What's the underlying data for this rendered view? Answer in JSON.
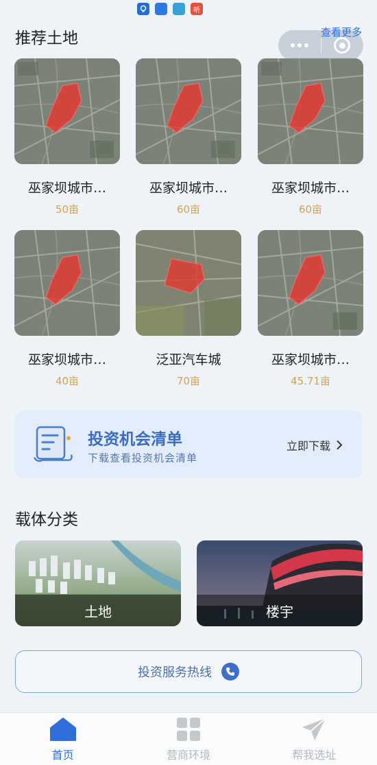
{
  "status_bar": {
    "app_badge": "听"
  },
  "header": {
    "title": "推荐土地",
    "view_more": "查看更多"
  },
  "lands": [
    {
      "name": "巫家坝城市…",
      "area": "50亩"
    },
    {
      "name": "巫家坝城市…",
      "area": "60亩"
    },
    {
      "name": "巫家坝城市…",
      "area": "60亩"
    },
    {
      "name": "巫家坝城市…",
      "area": "40亩"
    },
    {
      "name": "泛亚汽车城",
      "area": "70亩"
    },
    {
      "name": "巫家坝城市…",
      "area": "45.71亩"
    }
  ],
  "promo": {
    "title": "投资机会清单",
    "subtitle": "下载查看投资机会清单",
    "cta": "立即下载"
  },
  "categories": {
    "title": "载体分类",
    "items": [
      {
        "label": "土地"
      },
      {
        "label": "楼宇"
      }
    ]
  },
  "hotline": {
    "label": "投资服务热线"
  },
  "tabbar": {
    "items": [
      {
        "label": "首页",
        "icon": "home-icon",
        "active": true
      },
      {
        "label": "营商环境",
        "icon": "grid-icon",
        "active": false
      },
      {
        "label": "帮我选址",
        "icon": "paper-plane-icon",
        "active": false
      }
    ]
  },
  "colors": {
    "accent": "#2f6fd8",
    "area_text": "#d4a150",
    "parcel_red": "#e23a34"
  }
}
